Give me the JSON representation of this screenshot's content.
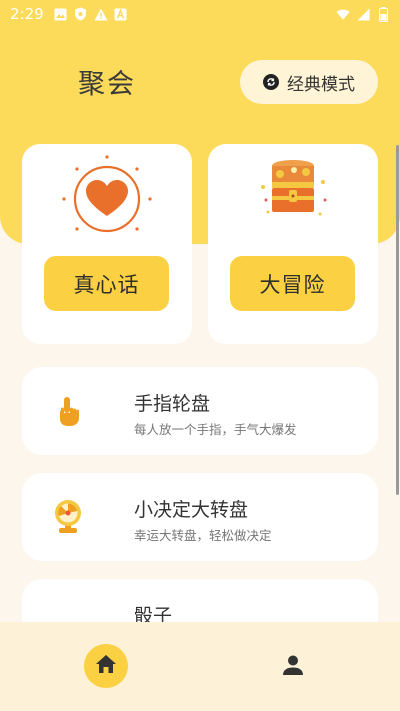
{
  "status_bar": {
    "time": "2:29",
    "left_icons": [
      "image-icon",
      "shield-icon",
      "warning-icon",
      "a-badge-icon"
    ],
    "right_icons": [
      "wifi-icon",
      "signal-icon",
      "battery-icon"
    ]
  },
  "header": {
    "title": "聚会",
    "mode_button_label": "经典模式"
  },
  "games": [
    {
      "label": "真心话",
      "icon": "heart-sun-icon"
    },
    {
      "label": "大冒险",
      "icon": "treasure-chest-icon"
    }
  ],
  "list": [
    {
      "title": "手指轮盘",
      "subtitle": "每人放一个手指，手气大爆发",
      "icon": "finger-pointer-icon"
    },
    {
      "title": "小决定大转盘",
      "subtitle": "幸运大转盘，轻松做决定",
      "icon": "spin-wheel-icon"
    },
    {
      "title": "骰子",
      "subtitle": "",
      "icon": "dice-icon"
    }
  ],
  "nav": {
    "items": [
      "home-icon",
      "profile-icon"
    ],
    "active": "home"
  },
  "colors": {
    "accent": "#fbd143",
    "header_bg": "#fddb5a",
    "page_bg": "#fdf6ec",
    "heart": "#e8702a"
  }
}
